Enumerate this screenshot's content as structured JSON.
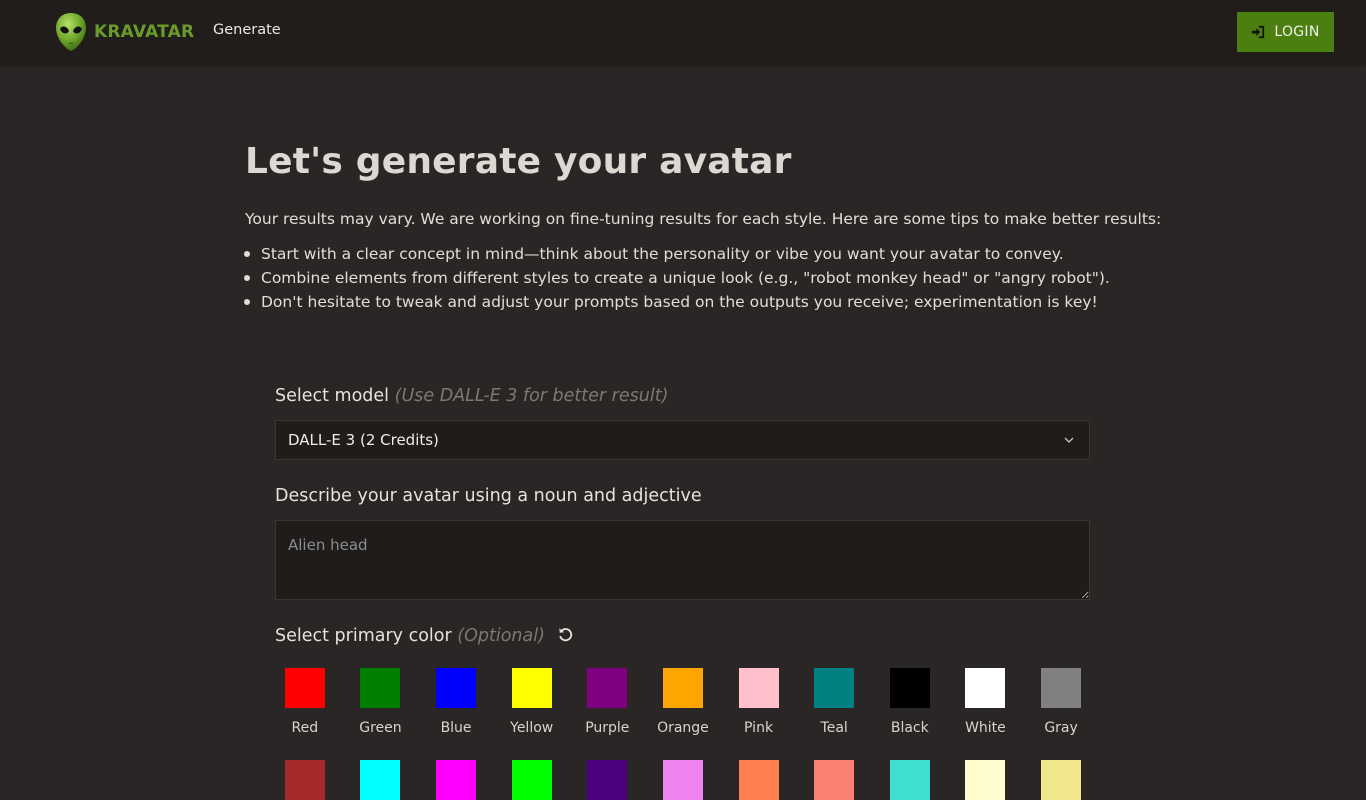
{
  "navbar": {
    "brand": "KRAVATAR",
    "links": [
      "Generate"
    ],
    "login_label": "LOGIN"
  },
  "page": {
    "title": "Let's generate your avatar",
    "intro": "Your results may vary. We are working on fine-tuning results for each style. Here are some tips to make better results:",
    "tips": [
      "Start with a clear concept in mind—think about the personality or vibe you want your avatar to convey.",
      "Combine elements from different styles to create a unique look (e.g., \"robot monkey head\" or \"angry robot\").",
      "Don't hesitate to tweak and adjust your prompts based on the outputs you receive; experimentation is key!"
    ]
  },
  "form": {
    "model_label": "Select model",
    "model_hint": "(Use DALL-E 3 for better result)",
    "model_value": "DALL-E 3 (2 Credits)",
    "description_label": "Describe your avatar using a noun and adjective",
    "description_placeholder": "Alien head",
    "color_label": "Select primary color",
    "color_hint": "(Optional)"
  },
  "colors": [
    {
      "name": "Red",
      "hex": "#ff0000"
    },
    {
      "name": "Green",
      "hex": "#008000"
    },
    {
      "name": "Blue",
      "hex": "#0000ff"
    },
    {
      "name": "Yellow",
      "hex": "#ffff00"
    },
    {
      "name": "Purple",
      "hex": "#800080"
    },
    {
      "name": "Orange",
      "hex": "#ffa500"
    },
    {
      "name": "Pink",
      "hex": "#ffc0cb"
    },
    {
      "name": "Teal",
      "hex": "#008080"
    },
    {
      "name": "Black",
      "hex": "#000000"
    },
    {
      "name": "White",
      "hex": "#ffffff"
    },
    {
      "name": "Gray",
      "hex": "#808080"
    }
  ],
  "colors_row2": [
    {
      "hex": "#a52a2a"
    },
    {
      "hex": "#00ffff"
    },
    {
      "hex": "#ff00ff"
    },
    {
      "hex": "#00ff00"
    },
    {
      "hex": "#4b0082"
    },
    {
      "hex": "#ee82ee"
    },
    {
      "hex": "#ff7f50"
    },
    {
      "hex": "#fa8072"
    },
    {
      "hex": "#40e0d0"
    },
    {
      "hex": "#fffdd0"
    },
    {
      "hex": "#f0e68c"
    }
  ],
  "theme": {
    "accent": "#4b7f0f",
    "brand_green": "#6a9b2a",
    "background": "#2a2625",
    "navbar": "#201d1b"
  }
}
